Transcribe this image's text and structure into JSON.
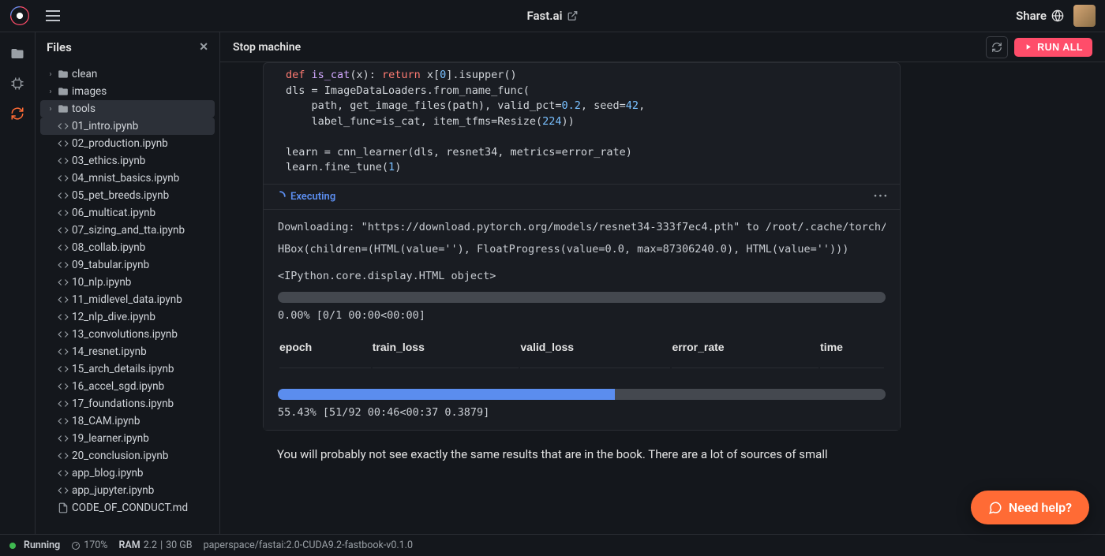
{
  "topbar": {
    "title": "Fast.ai",
    "share_label": "Share"
  },
  "sidebar": {
    "title": "Files",
    "folders": [
      {
        "name": "clean"
      },
      {
        "name": "images"
      },
      {
        "name": "tools"
      }
    ],
    "files": [
      "01_intro.ipynb",
      "02_production.ipynb",
      "03_ethics.ipynb",
      "04_mnist_basics.ipynb",
      "05_pet_breeds.ipynb",
      "06_multicat.ipynb",
      "07_sizing_and_tta.ipynb",
      "08_collab.ipynb",
      "09_tabular.ipynb",
      "10_nlp.ipynb",
      "11_midlevel_data.ipynb",
      "12_nlp_dive.ipynb",
      "13_convolutions.ipynb",
      "14_resnet.ipynb",
      "15_arch_details.ipynb",
      "16_accel_sgd.ipynb",
      "17_foundations.ipynb",
      "18_CAM.ipynb",
      "19_learner.ipynb",
      "20_conclusion.ipynb",
      "app_blog.ipynb",
      "app_jupyter.ipynb"
    ],
    "other_files": [
      "CODE_OF_CONDUCT.md"
    ]
  },
  "toolbar": {
    "stop": "Stop machine",
    "run_all": "RUN ALL"
  },
  "cell": {
    "status": "Executing",
    "output": {
      "line1": "Downloading: \"https://download.pytorch.org/models/resnet34-333f7ec4.pth\" to /root/.cache/torch/hub/check",
      "line2": "HBox(children=(HTML(value=''), FloatProgress(value=0.0, max=87306240.0), HTML(value='')))",
      "line3": "<IPython.core.display.HTML object>",
      "p1_text": "0.00% [0/1 00:00<00:00]",
      "p1_pct": 0,
      "headers": [
        "epoch",
        "train_loss",
        "valid_loss",
        "error_rate",
        "time"
      ],
      "p2_text": "55.43% [51/92 00:46<00:37 0.3879]",
      "p2_pct": 55.43
    }
  },
  "body_text": "You will probably not see exactly the same results that are in the book. There are a lot of sources of small",
  "status": {
    "state": "Running",
    "cpu": "170%",
    "ram_label": "RAM",
    "ram": "2.2",
    "disk": "30 GB",
    "image": "paperspace/fastai:2.0-CUDA9.2-fastbook-v0.1.0"
  },
  "help": "Need help?"
}
